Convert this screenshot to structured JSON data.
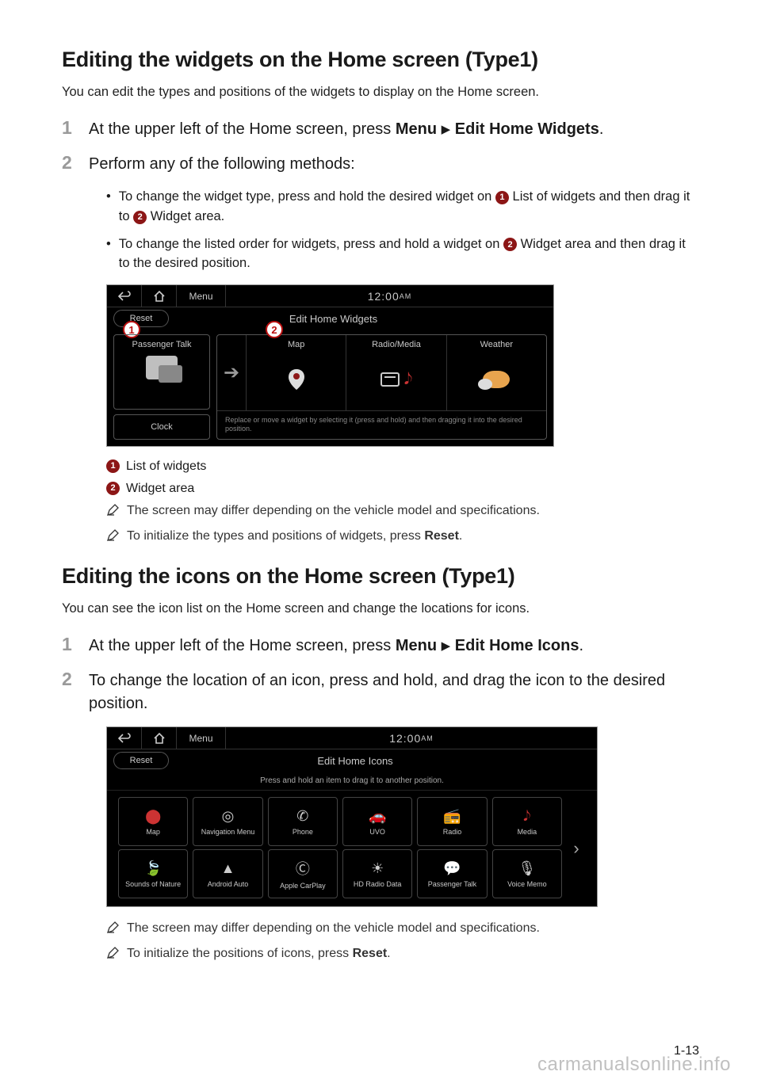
{
  "section1": {
    "heading": "Editing the widgets on the Home screen (Type1)",
    "intro": "You can edit the types and positions of the widgets to display on the Home screen.",
    "step1_num": "1",
    "step1_a": "At the upper left of the Home screen, press ",
    "step1_b1": "Menu",
    "step1_arrow": "▶",
    "step1_b2": "Edit Home Widgets",
    "step1_c": ".",
    "step2_num": "2",
    "step2_text": "Perform any of the following methods:",
    "bullet1_a": "To change the widget type, press and hold the desired widget on ",
    "bullet1_b": " List of widgets and then drag it to ",
    "bullet1_c": " Widget area.",
    "bullet2_a": "To change the listed order for widgets, press and hold a widget on ",
    "bullet2_b": " Widget area and then drag it to the desired position.",
    "circ1": "1",
    "circ2": "2",
    "ss1": {
      "menu": "Menu",
      "time": "12:00",
      "am": "AM",
      "reset": "Reset",
      "title": "Edit Home Widgets",
      "passenger": "Passenger Talk",
      "clock": "Clock",
      "map": "Map",
      "radiomedia": "Radio/Media",
      "weather": "Weather",
      "hint": "Replace or move a widget by selecting it (press and hold) and then dragging it into the desired position."
    },
    "legend1": "List of widgets",
    "legend2": "Widget area",
    "note1": "The screen may differ depending on the vehicle model and specifications.",
    "note2_a": "To initialize the types and positions of widgets, press ",
    "note2_b": "Reset",
    "note2_c": "."
  },
  "section2": {
    "heading": "Editing the icons on the Home screen (Type1)",
    "intro": "You can see the icon list on the Home screen and change the locations for icons.",
    "step1_num": "1",
    "step1_a": "At the upper left of the Home screen, press ",
    "step1_b1": "Menu",
    "step1_arrow": "▶",
    "step1_b2": "Edit Home Icons",
    "step1_c": ".",
    "step2_num": "2",
    "step2_text": "To change the location of an icon, press and hold, and drag the icon to the desired position.",
    "ss2": {
      "menu": "Menu",
      "time": "12:00",
      "am": "AM",
      "reset": "Reset",
      "title": "Edit Home Icons",
      "hint": "Press and hold an item to drag it to another position.",
      "icons": {
        "map": "Map",
        "nav": "Navigation Menu",
        "phone": "Phone",
        "uvo": "UVO",
        "radio": "Radio",
        "media": "Media",
        "sounds": "Sounds of Nature",
        "android": "Android Auto",
        "carplay": "Apple CarPlay",
        "hd": "HD Radio Data",
        "ptalk": "Passenger Talk",
        "voice": "Voice Memo"
      }
    },
    "note1": "The screen may differ depending on the vehicle model and specifications.",
    "note2_a": "To initialize the positions of icons, press ",
    "note2_b": "Reset",
    "note2_c": "."
  },
  "pagenum": "1-13",
  "watermark": "carmanualsonline.info"
}
